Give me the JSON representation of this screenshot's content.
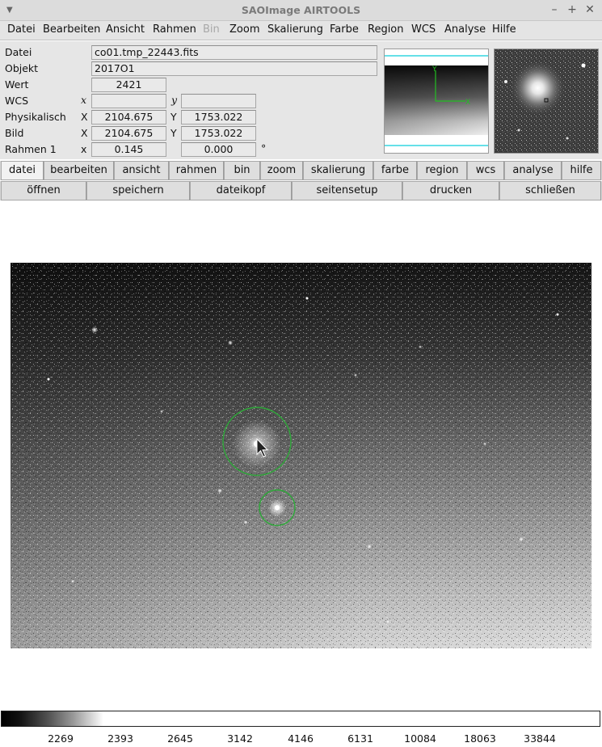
{
  "window": {
    "title": "SAOImage AIRTOOLS"
  },
  "menubar": [
    {
      "label": "Datei",
      "enabled": true
    },
    {
      "label": "Bearbeiten",
      "enabled": true
    },
    {
      "label": "Ansicht",
      "enabled": true
    },
    {
      "label": "Rahmen",
      "enabled": true
    },
    {
      "label": "Bin",
      "enabled": false
    },
    {
      "label": "Zoom",
      "enabled": true
    },
    {
      "label": "Skalierung",
      "enabled": true
    },
    {
      "label": "Farbe",
      "enabled": true
    },
    {
      "label": "Region",
      "enabled": true
    },
    {
      "label": "WCS",
      "enabled": true
    },
    {
      "label": "Analyse",
      "enabled": true
    },
    {
      "label": "Hilfe",
      "enabled": true
    }
  ],
  "info": {
    "file_label": "Datei",
    "file_value": "co01.tmp_22443.fits",
    "object_label": "Objekt",
    "object_value": "2017O1",
    "value_label": "Wert",
    "value_value": "2421",
    "wcs_label": "WCS",
    "wcs_x_axis": "x",
    "wcs_y_axis": "y",
    "wcs_x_value": "",
    "wcs_y_value": "",
    "physical_label": "Physikalisch",
    "physical_x_axis": "X",
    "physical_y_axis": "Y",
    "physical_x_value": "2104.675",
    "physical_y_value": "1753.022",
    "image_label": "Bild",
    "image_x_axis": "X",
    "image_y_axis": "Y",
    "image_x_value": "2104.675",
    "image_y_value": "1753.022",
    "frame_label": "Rahmen 1",
    "frame_axis": "x",
    "frame_zoom_value": "0.145",
    "frame_angle_value": "0.000",
    "frame_angle_unit": "°"
  },
  "compass": {
    "north_label": "Y",
    "east_label": "X",
    "color": "#22c022"
  },
  "button_bar_main": [
    {
      "label": "datei",
      "selected": true
    },
    {
      "label": "bearbeiten",
      "selected": false
    },
    {
      "label": "ansicht",
      "selected": false
    },
    {
      "label": "rahmen",
      "selected": false
    },
    {
      "label": "bin",
      "selected": false
    },
    {
      "label": "zoom",
      "selected": false
    },
    {
      "label": "skalierung",
      "selected": false
    },
    {
      "label": "farbe",
      "selected": false
    },
    {
      "label": "region",
      "selected": false
    },
    {
      "label": "wcs",
      "selected": false
    },
    {
      "label": "analyse",
      "selected": false
    },
    {
      "label": "hilfe",
      "selected": false
    }
  ],
  "button_bar_sub": [
    {
      "label": "öffnen"
    },
    {
      "label": "speichern"
    },
    {
      "label": "dateikopf"
    },
    {
      "label": "seitensetup"
    },
    {
      "label": "drucken"
    },
    {
      "label": "schließen"
    }
  ],
  "regions": {
    "color": "#2fa83a",
    "panner_box_color": "#33d6e0"
  },
  "colorbar": {
    "ticks": [
      "2269",
      "2393",
      "2645",
      "3142",
      "4146",
      "6131",
      "10084",
      "18063",
      "33844"
    ]
  }
}
